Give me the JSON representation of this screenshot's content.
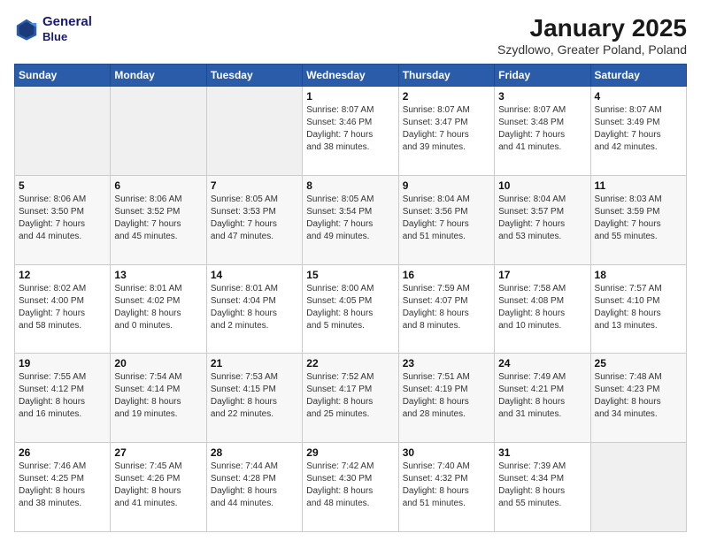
{
  "header": {
    "logo_line1": "General",
    "logo_line2": "Blue",
    "main_title": "January 2025",
    "sub_title": "Szydlowo, Greater Poland, Poland"
  },
  "days_of_week": [
    "Sunday",
    "Monday",
    "Tuesday",
    "Wednesday",
    "Thursday",
    "Friday",
    "Saturday"
  ],
  "weeks": [
    [
      {
        "day": "",
        "info": ""
      },
      {
        "day": "",
        "info": ""
      },
      {
        "day": "",
        "info": ""
      },
      {
        "day": "1",
        "info": "Sunrise: 8:07 AM\nSunset: 3:46 PM\nDaylight: 7 hours\nand 38 minutes."
      },
      {
        "day": "2",
        "info": "Sunrise: 8:07 AM\nSunset: 3:47 PM\nDaylight: 7 hours\nand 39 minutes."
      },
      {
        "day": "3",
        "info": "Sunrise: 8:07 AM\nSunset: 3:48 PM\nDaylight: 7 hours\nand 41 minutes."
      },
      {
        "day": "4",
        "info": "Sunrise: 8:07 AM\nSunset: 3:49 PM\nDaylight: 7 hours\nand 42 minutes."
      }
    ],
    [
      {
        "day": "5",
        "info": "Sunrise: 8:06 AM\nSunset: 3:50 PM\nDaylight: 7 hours\nand 44 minutes."
      },
      {
        "day": "6",
        "info": "Sunrise: 8:06 AM\nSunset: 3:52 PM\nDaylight: 7 hours\nand 45 minutes."
      },
      {
        "day": "7",
        "info": "Sunrise: 8:05 AM\nSunset: 3:53 PM\nDaylight: 7 hours\nand 47 minutes."
      },
      {
        "day": "8",
        "info": "Sunrise: 8:05 AM\nSunset: 3:54 PM\nDaylight: 7 hours\nand 49 minutes."
      },
      {
        "day": "9",
        "info": "Sunrise: 8:04 AM\nSunset: 3:56 PM\nDaylight: 7 hours\nand 51 minutes."
      },
      {
        "day": "10",
        "info": "Sunrise: 8:04 AM\nSunset: 3:57 PM\nDaylight: 7 hours\nand 53 minutes."
      },
      {
        "day": "11",
        "info": "Sunrise: 8:03 AM\nSunset: 3:59 PM\nDaylight: 7 hours\nand 55 minutes."
      }
    ],
    [
      {
        "day": "12",
        "info": "Sunrise: 8:02 AM\nSunset: 4:00 PM\nDaylight: 7 hours\nand 58 minutes."
      },
      {
        "day": "13",
        "info": "Sunrise: 8:01 AM\nSunset: 4:02 PM\nDaylight: 8 hours\nand 0 minutes."
      },
      {
        "day": "14",
        "info": "Sunrise: 8:01 AM\nSunset: 4:04 PM\nDaylight: 8 hours\nand 2 minutes."
      },
      {
        "day": "15",
        "info": "Sunrise: 8:00 AM\nSunset: 4:05 PM\nDaylight: 8 hours\nand 5 minutes."
      },
      {
        "day": "16",
        "info": "Sunrise: 7:59 AM\nSunset: 4:07 PM\nDaylight: 8 hours\nand 8 minutes."
      },
      {
        "day": "17",
        "info": "Sunrise: 7:58 AM\nSunset: 4:08 PM\nDaylight: 8 hours\nand 10 minutes."
      },
      {
        "day": "18",
        "info": "Sunrise: 7:57 AM\nSunset: 4:10 PM\nDaylight: 8 hours\nand 13 minutes."
      }
    ],
    [
      {
        "day": "19",
        "info": "Sunrise: 7:55 AM\nSunset: 4:12 PM\nDaylight: 8 hours\nand 16 minutes."
      },
      {
        "day": "20",
        "info": "Sunrise: 7:54 AM\nSunset: 4:14 PM\nDaylight: 8 hours\nand 19 minutes."
      },
      {
        "day": "21",
        "info": "Sunrise: 7:53 AM\nSunset: 4:15 PM\nDaylight: 8 hours\nand 22 minutes."
      },
      {
        "day": "22",
        "info": "Sunrise: 7:52 AM\nSunset: 4:17 PM\nDaylight: 8 hours\nand 25 minutes."
      },
      {
        "day": "23",
        "info": "Sunrise: 7:51 AM\nSunset: 4:19 PM\nDaylight: 8 hours\nand 28 minutes."
      },
      {
        "day": "24",
        "info": "Sunrise: 7:49 AM\nSunset: 4:21 PM\nDaylight: 8 hours\nand 31 minutes."
      },
      {
        "day": "25",
        "info": "Sunrise: 7:48 AM\nSunset: 4:23 PM\nDaylight: 8 hours\nand 34 minutes."
      }
    ],
    [
      {
        "day": "26",
        "info": "Sunrise: 7:46 AM\nSunset: 4:25 PM\nDaylight: 8 hours\nand 38 minutes."
      },
      {
        "day": "27",
        "info": "Sunrise: 7:45 AM\nSunset: 4:26 PM\nDaylight: 8 hours\nand 41 minutes."
      },
      {
        "day": "28",
        "info": "Sunrise: 7:44 AM\nSunset: 4:28 PM\nDaylight: 8 hours\nand 44 minutes."
      },
      {
        "day": "29",
        "info": "Sunrise: 7:42 AM\nSunset: 4:30 PM\nDaylight: 8 hours\nand 48 minutes."
      },
      {
        "day": "30",
        "info": "Sunrise: 7:40 AM\nSunset: 4:32 PM\nDaylight: 8 hours\nand 51 minutes."
      },
      {
        "day": "31",
        "info": "Sunrise: 7:39 AM\nSunset: 4:34 PM\nDaylight: 8 hours\nand 55 minutes."
      },
      {
        "day": "",
        "info": ""
      }
    ]
  ]
}
